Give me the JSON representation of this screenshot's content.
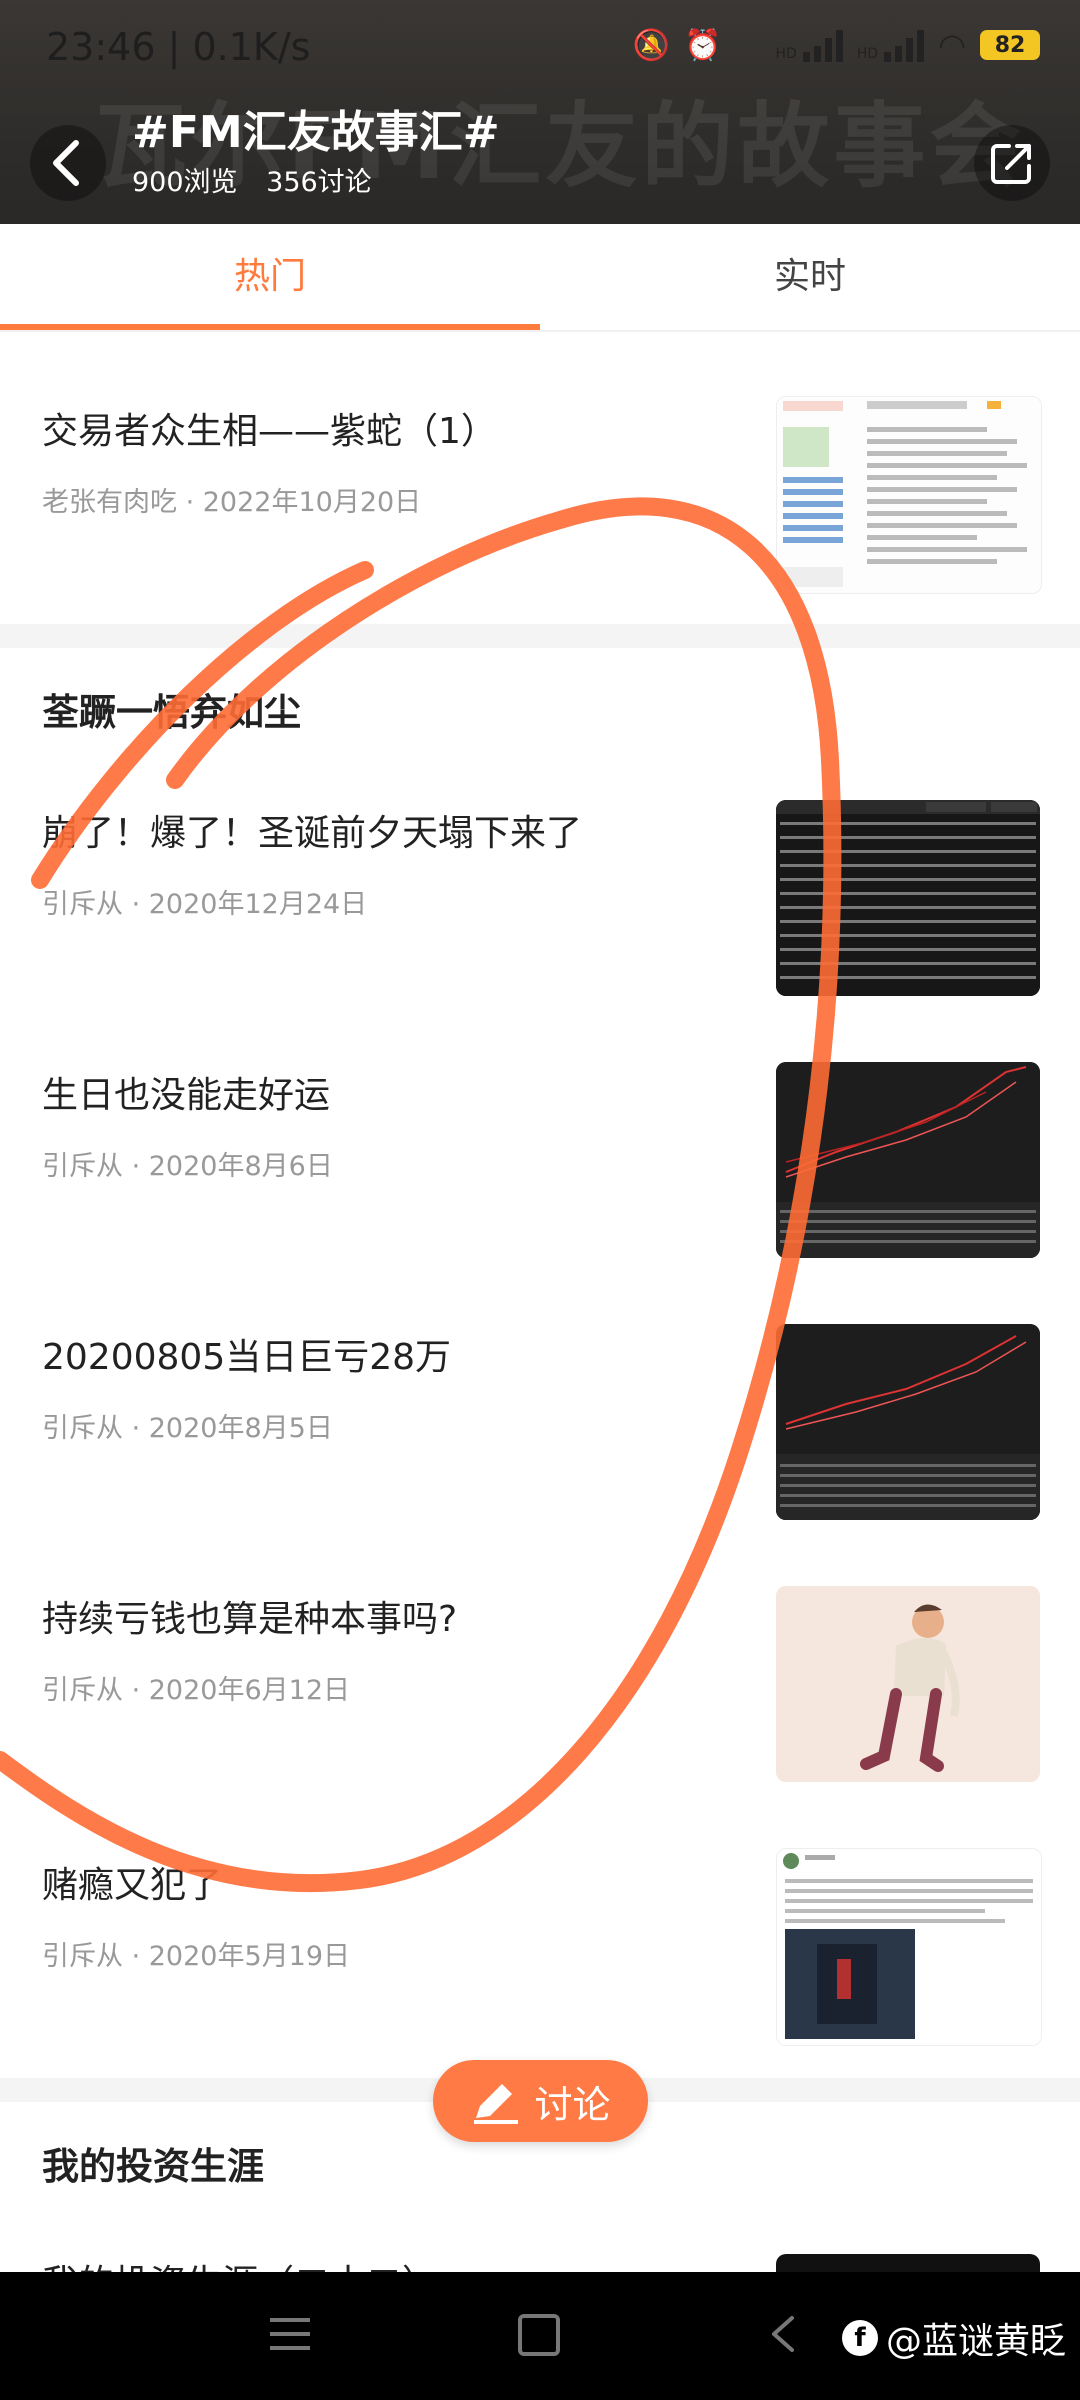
{
  "status_bar": {
    "time_speed": "23:46 | 0.1K/s",
    "battery": "82",
    "hd1": "HD",
    "hd2": "HD"
  },
  "header": {
    "watermark": "瓦尔FM汇友的故事会",
    "title": "#FM汇友故事汇#",
    "views": "900浏览",
    "discussions": "356讨论"
  },
  "tabs": [
    {
      "label": "热门",
      "active": true
    },
    {
      "label": "实时",
      "active": false
    }
  ],
  "articles": [
    {
      "title": "交易者众生相——紫蛇（1）",
      "meta": "老张有肉吃 · 2022年10月20日",
      "thumb": "document-screenshot"
    },
    {
      "title": "崩了！爆了！圣诞前夕天塌下来了",
      "meta": "引斥从 · 2020年12月24日",
      "thumb": "trading-table"
    },
    {
      "title": "生日也没能走好运",
      "meta": "引斥从 · 2020年8月6日",
      "thumb": "trading-chart"
    },
    {
      "title": "20200805当日巨亏28万",
      "meta": "引斥从 · 2020年8月5日",
      "thumb": "trading-chart"
    },
    {
      "title": "持续亏钱也算是种本事吗?",
      "meta": "引斥从 · 2020年6月12日",
      "thumb": "tired-man-illustration"
    },
    {
      "title": "赌瘾又犯了",
      "meta": "引斥从 · 2020年5月19日",
      "thumb": "post-screenshot"
    }
  ],
  "sections": [
    {
      "title": "荃蹶一悟弃如尘"
    },
    {
      "title": "我的投资生涯"
    }
  ],
  "partial_article": {
    "title": "我的投资生涯（二十二）"
  },
  "discuss_button": {
    "label": "讨论"
  },
  "author_watermark": "@蓝谜黄眨",
  "colors": {
    "accent": "#ff7a3d",
    "annotation": "#ff6b35"
  }
}
